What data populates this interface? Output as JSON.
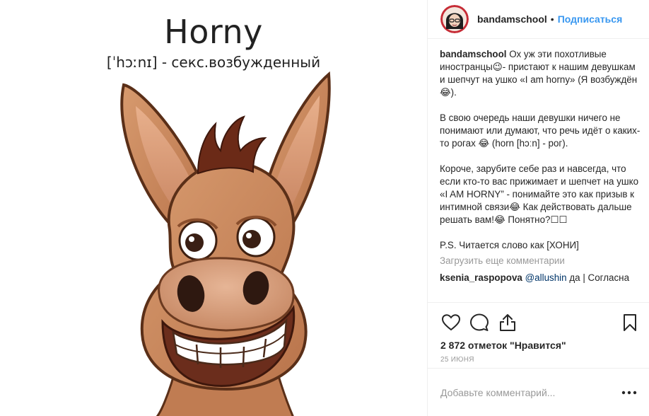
{
  "media": {
    "title": "Horny",
    "subtitle": "[ˈhɔːnɪ] - секс.возбужденный"
  },
  "header": {
    "username": "bandamschool",
    "separator": "•",
    "follow_label": "Подписаться"
  },
  "caption": {
    "username": "bandamschool",
    "paragraphs": [
      "Ох уж эти похотливые иностранцы😉- пристают к нашим девушкам и шепчут на ушко «I am horny» (Я возбуждён😂).",
      "В свою очередь наши девушки ничего не понимают или думают, что речь идёт о каких-то рогах 😂 (horn [hɔːn] - рог).",
      "Короче, зарубите себе раз и навсегда, что если кто-то вас прижимает и шепчет на ушко «I AM HORNY” - понимайте это как призыв к интимной связи😂 Как действовать дальше решать вам!😂 Понятно?☐☐",
      "P.S. Читается слово как [ХОНИ]"
    ]
  },
  "load_more_label": "Загрузить еще комментарии",
  "partial_comment": {
    "username": "ksenia_raspopova",
    "mention": "@allushin",
    "text": "да | Согласна"
  },
  "likes_text": "2 872 отметок \"Нравится\"",
  "date_text": "25 июня",
  "add_comment_placeholder": "Добавьте комментарий...",
  "icons": {
    "like": "heart-icon",
    "comment": "comment-icon",
    "share": "share-icon",
    "save": "bookmark-icon",
    "more": "more-options-icon"
  },
  "colors": {
    "link": "#3897f0",
    "muted": "#999999",
    "text": "#262626",
    "border": "#efefef"
  }
}
